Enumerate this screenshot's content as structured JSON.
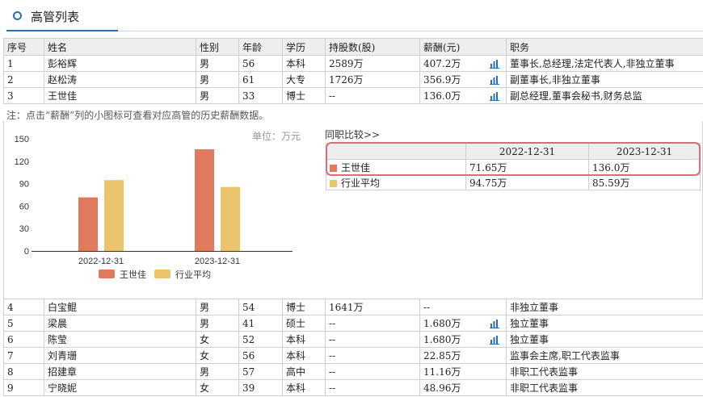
{
  "header": {
    "title": "高管列表"
  },
  "table": {
    "columns": [
      "序号",
      "姓名",
      "性别",
      "年龄",
      "学历",
      "持股数(股)",
      "薪酬(元)",
      "职务"
    ],
    "top_rows": [
      {
        "no": "1",
        "name": "彭裕辉",
        "gender": "男",
        "age": "56",
        "edu": "本科",
        "shares": "2589万",
        "salary": "407.2万",
        "chart": true,
        "title": "董事长,总经理,法定代表人,非独立董事"
      },
      {
        "no": "2",
        "name": "赵松涛",
        "gender": "男",
        "age": "61",
        "edu": "大专",
        "shares": "1726万",
        "salary": "356.9万",
        "chart": true,
        "title": "副董事长,非独立董事"
      },
      {
        "no": "3",
        "name": "王世佳",
        "gender": "男",
        "age": "33",
        "edu": "博士",
        "shares": "--",
        "salary": "136.0万",
        "chart": true,
        "title": "副总经理,董事会秘书,财务总监"
      }
    ],
    "bottom_rows": [
      {
        "no": "4",
        "name": "白宝鲲",
        "gender": "男",
        "age": "54",
        "edu": "博士",
        "shares": "1641万",
        "salary": "--",
        "chart": false,
        "title": "非独立董事"
      },
      {
        "no": "5",
        "name": "梁晨",
        "gender": "男",
        "age": "41",
        "edu": "硕士",
        "shares": "--",
        "salary": "1.680万",
        "chart": true,
        "title": "独立董事"
      },
      {
        "no": "6",
        "name": "陈莹",
        "gender": "女",
        "age": "52",
        "edu": "本科",
        "shares": "--",
        "salary": "1.680万",
        "chart": true,
        "title": "独立董事"
      },
      {
        "no": "7",
        "name": "刘青珊",
        "gender": "女",
        "age": "56",
        "edu": "本科",
        "shares": "--",
        "salary": "22.85万",
        "chart": false,
        "title": "监事会主席,职工代表监事"
      },
      {
        "no": "8",
        "name": "招建章",
        "gender": "男",
        "age": "57",
        "edu": "高中",
        "shares": "--",
        "salary": "11.16万",
        "chart": false,
        "title": "非职工代表监事"
      },
      {
        "no": "9",
        "name": "宁晓妮",
        "gender": "女",
        "age": "39",
        "edu": "本科",
        "shares": "--",
        "salary": "48.96万",
        "chart": false,
        "title": "非职工代表监事"
      }
    ]
  },
  "note": "注：点击“薪酬”列的小图标可查看对应高管的历史薪酬数据。",
  "comparison": {
    "title": "同职比较>>",
    "headers": [
      "",
      "2022-12-31",
      "2023-12-31"
    ],
    "rows": [
      {
        "label": "王世佳",
        "color": "#e07a5f",
        "v1": "71.65万",
        "v2": "136.0万"
      },
      {
        "label": "行业平均",
        "color": "#e9c46a",
        "v1": "94.75万",
        "v2": "85.59万"
      }
    ]
  },
  "chart_data": {
    "type": "bar",
    "unit_label": "单位：万元",
    "categories": [
      "2022-12-31",
      "2023-12-31"
    ],
    "series": [
      {
        "name": "王世佳",
        "color": "#e07a5f",
        "values": [
          71.65,
          136.0
        ]
      },
      {
        "name": "行业平均",
        "color": "#e9c46a",
        "values": [
          94.75,
          85.59
        ]
      }
    ],
    "yticks": [
      0,
      30,
      60,
      90,
      120,
      150
    ],
    "ylim": [
      0,
      150
    ],
    "legend": "bottom",
    "grid": false
  },
  "colors": {
    "accent": "#2b6fb1",
    "chart_icon": "#2b6fb1",
    "highlight": "#e06a78"
  }
}
